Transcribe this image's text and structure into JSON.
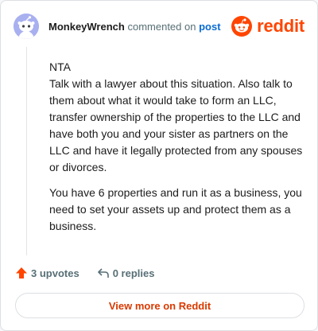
{
  "header": {
    "author": "MonkeyWrench",
    "action_text": "commented on",
    "post_link": "post",
    "brand_name": "reddit"
  },
  "comment": {
    "paragraphs": [
      "NTA\nTalk with a lawyer about this situation. Also talk to them about what it would take to form an LLC, transfer ownership of the properties to the LLC and have both you and your sister as partners on the LLC and have it legally protected from any spouses or divorces.",
      "You have 6 properties and run it as a business, you need to set your assets up and protect them as a business."
    ]
  },
  "actions": {
    "upvotes_label": "3 upvotes",
    "replies_label": "0 replies"
  },
  "footer": {
    "view_more_label": "View more on Reddit"
  },
  "colors": {
    "brand": "#ff4500",
    "link": "#0a6bd1",
    "view_more": "#d93a00",
    "avatar_bg": "#a8b0f0"
  },
  "icons": {
    "avatar": "snoo-avatar-icon",
    "logo": "reddit-logo-icon",
    "upvote": "upvote-arrow-icon",
    "reply": "reply-arrow-icon"
  }
}
